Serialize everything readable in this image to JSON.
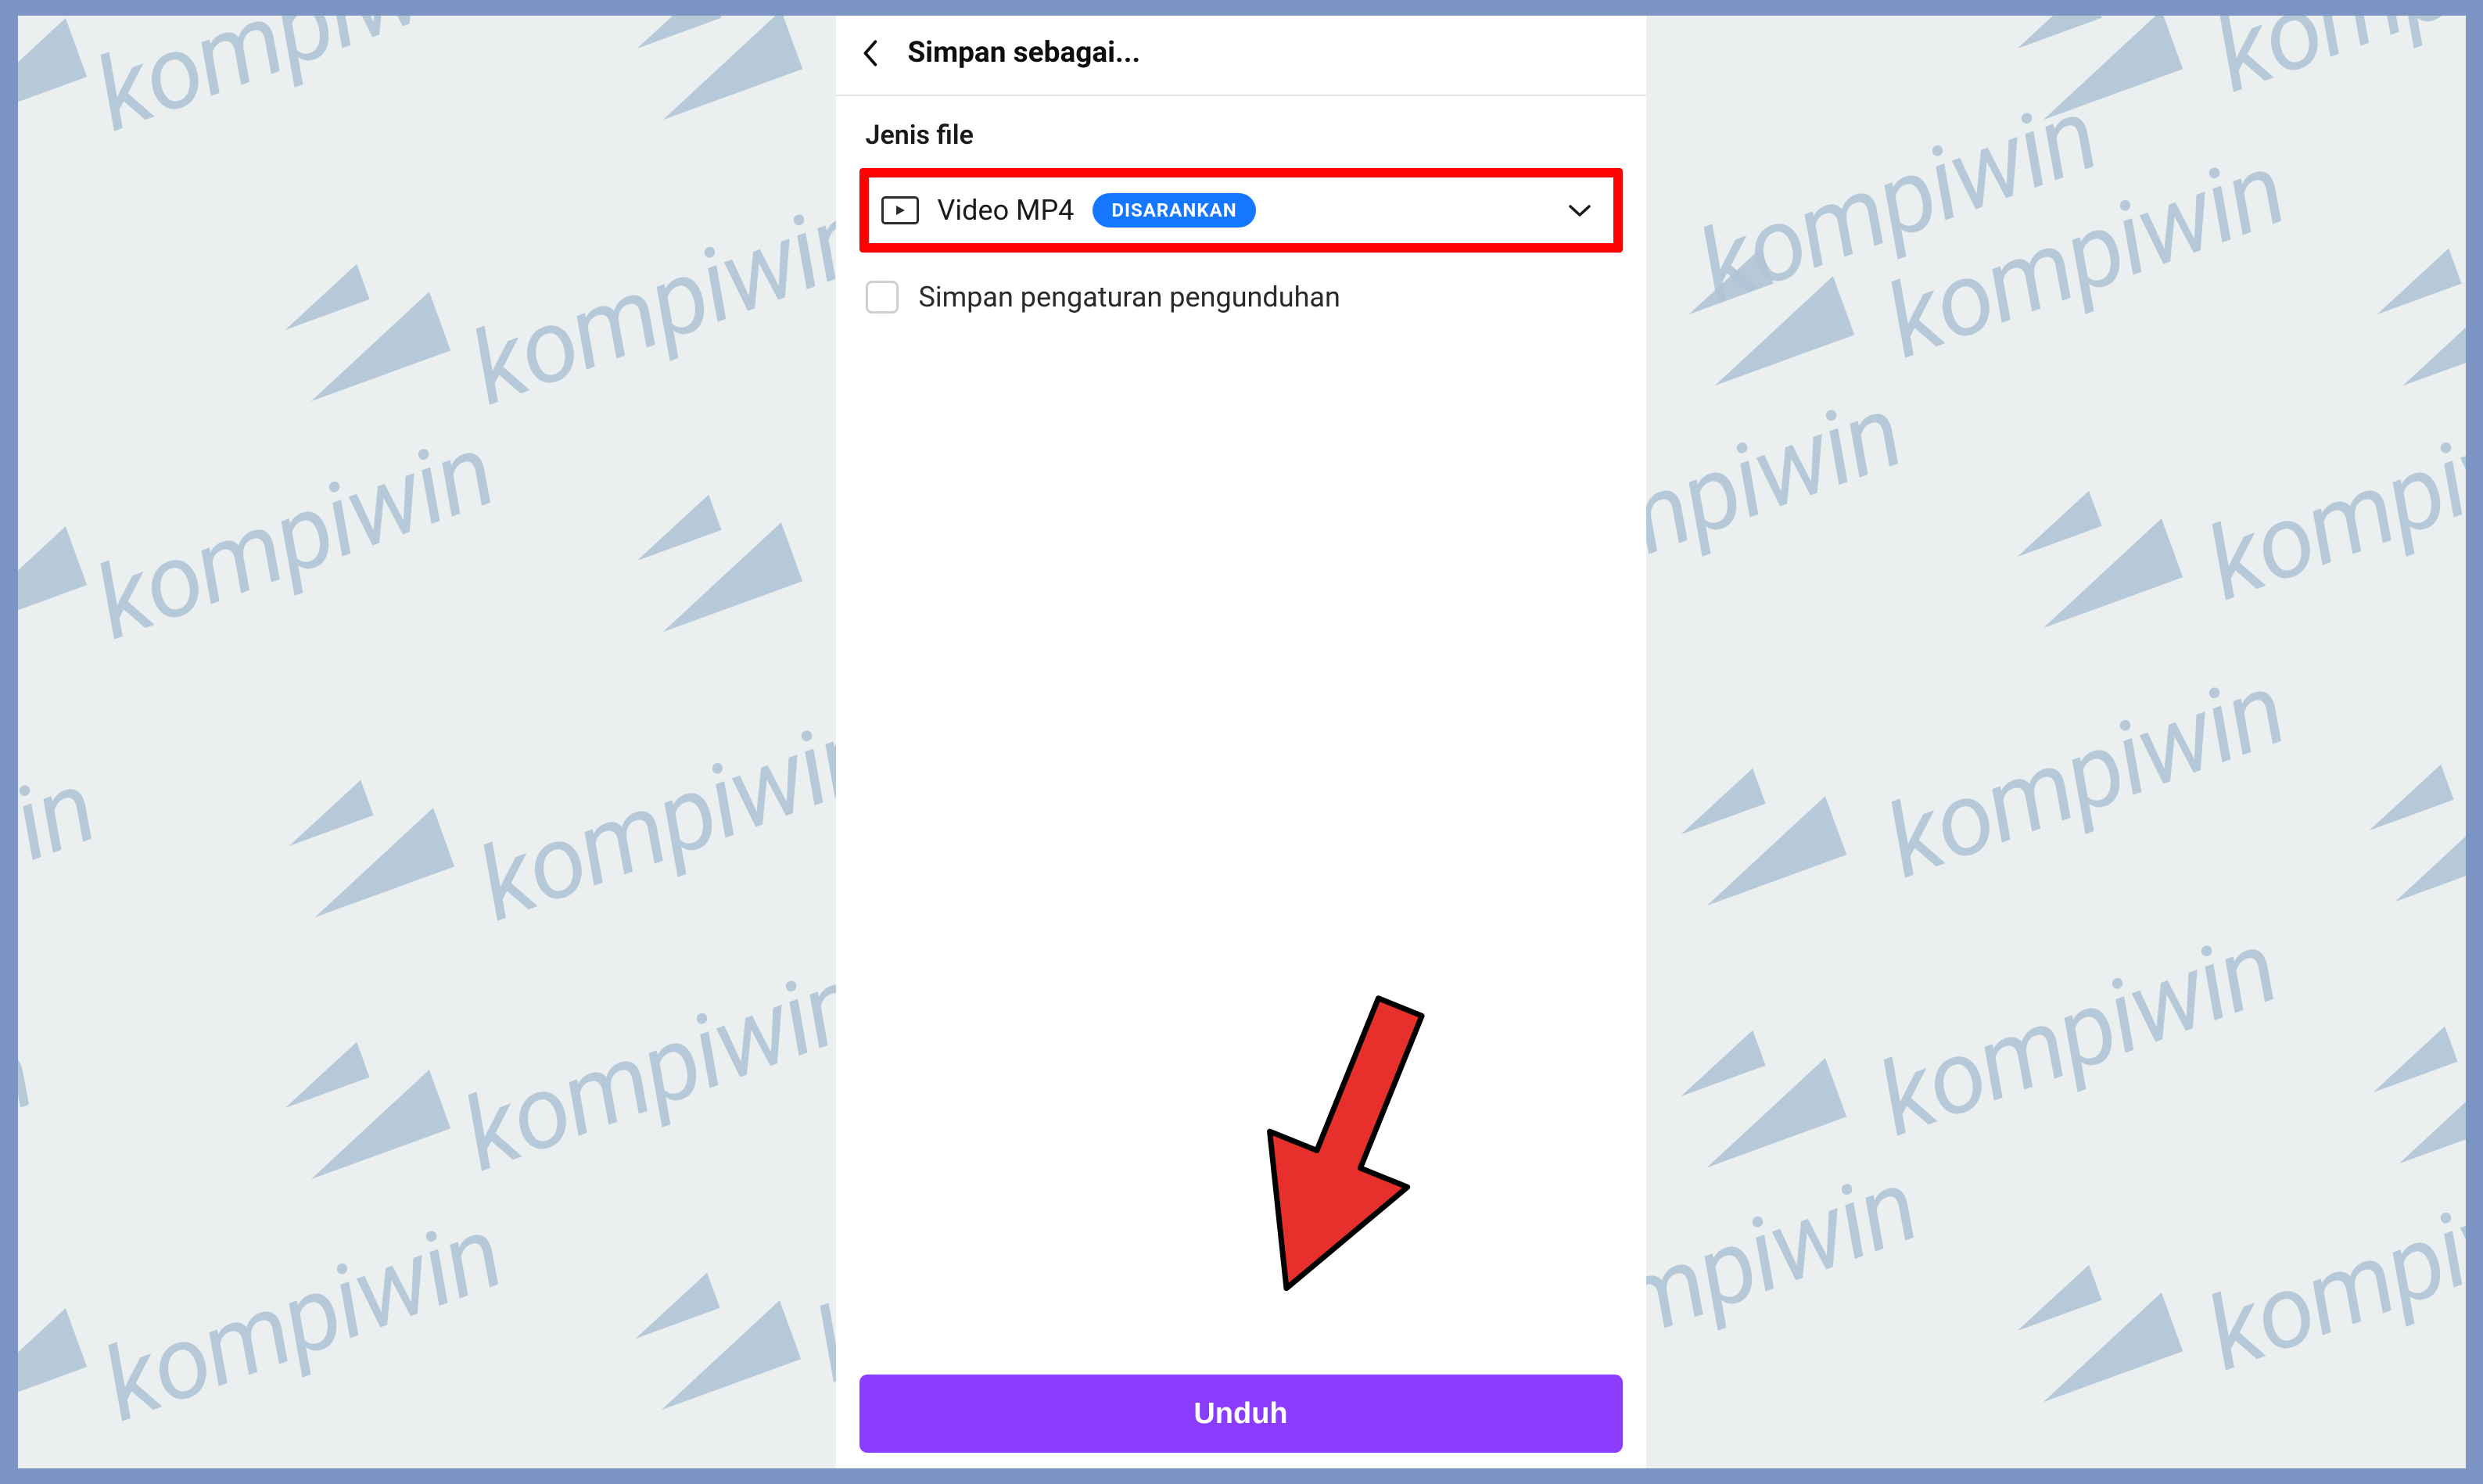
{
  "watermark": "kompiwin",
  "header": {
    "title": "Simpan sebagai..."
  },
  "fileType": {
    "sectionLabel": "Jenis file",
    "selectedLabel": "Video MP4",
    "badge": "DISARANKAN"
  },
  "saveSettings": {
    "label": "Simpan pengaturan pengunduhan"
  },
  "download": {
    "label": "Unduh"
  }
}
